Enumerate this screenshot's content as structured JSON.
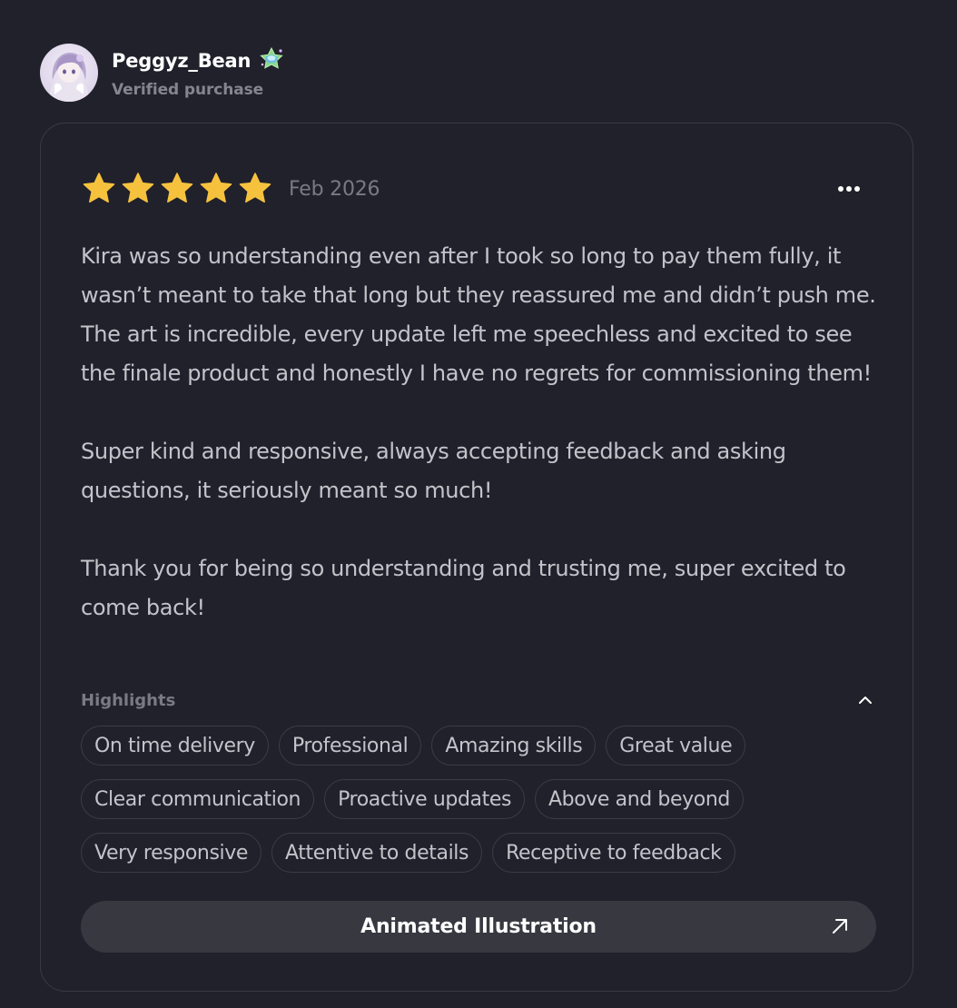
{
  "user": {
    "username": "Peggyz_Bean",
    "badge_icon": "green-star-badge-icon",
    "status": "Verified purchase",
    "avatar_icon": "anime-avatar"
  },
  "review": {
    "rating": 5,
    "rating_max": 5,
    "star_color": "#f6c23e",
    "date": "Feb 2026",
    "paragraphs": [
      "Kira was so understanding even after I took so long to pay them fully, it wasn’t meant to take that long but they reassured me and didn’t push me. The art is incredible, every update left me speechless and excited to see the finale product and honestly I have no regrets for commissioning them!",
      "Super kind and responsive, always accepting feedback and asking questions, it seriously meant so much!",
      "Thank you for being so understanding and trusting me, super excited to come back!"
    ]
  },
  "highlights": {
    "label": "Highlights",
    "tags": [
      [
        "On time delivery",
        "Professional",
        "Amazing skills",
        "Great value"
      ],
      [
        "Clear communication",
        "Proactive updates",
        "Above and beyond"
      ],
      [
        "Very responsive",
        "Attentive to details",
        "Receptive to feedback"
      ]
    ]
  },
  "category_button": {
    "label": "Animated Illustration",
    "icon": "arrow-up-right-icon"
  },
  "colors": {
    "background": "#21212b",
    "card_border": "#3a3a45",
    "button_bg": "#383841",
    "accent_star": "#f6c23e"
  }
}
